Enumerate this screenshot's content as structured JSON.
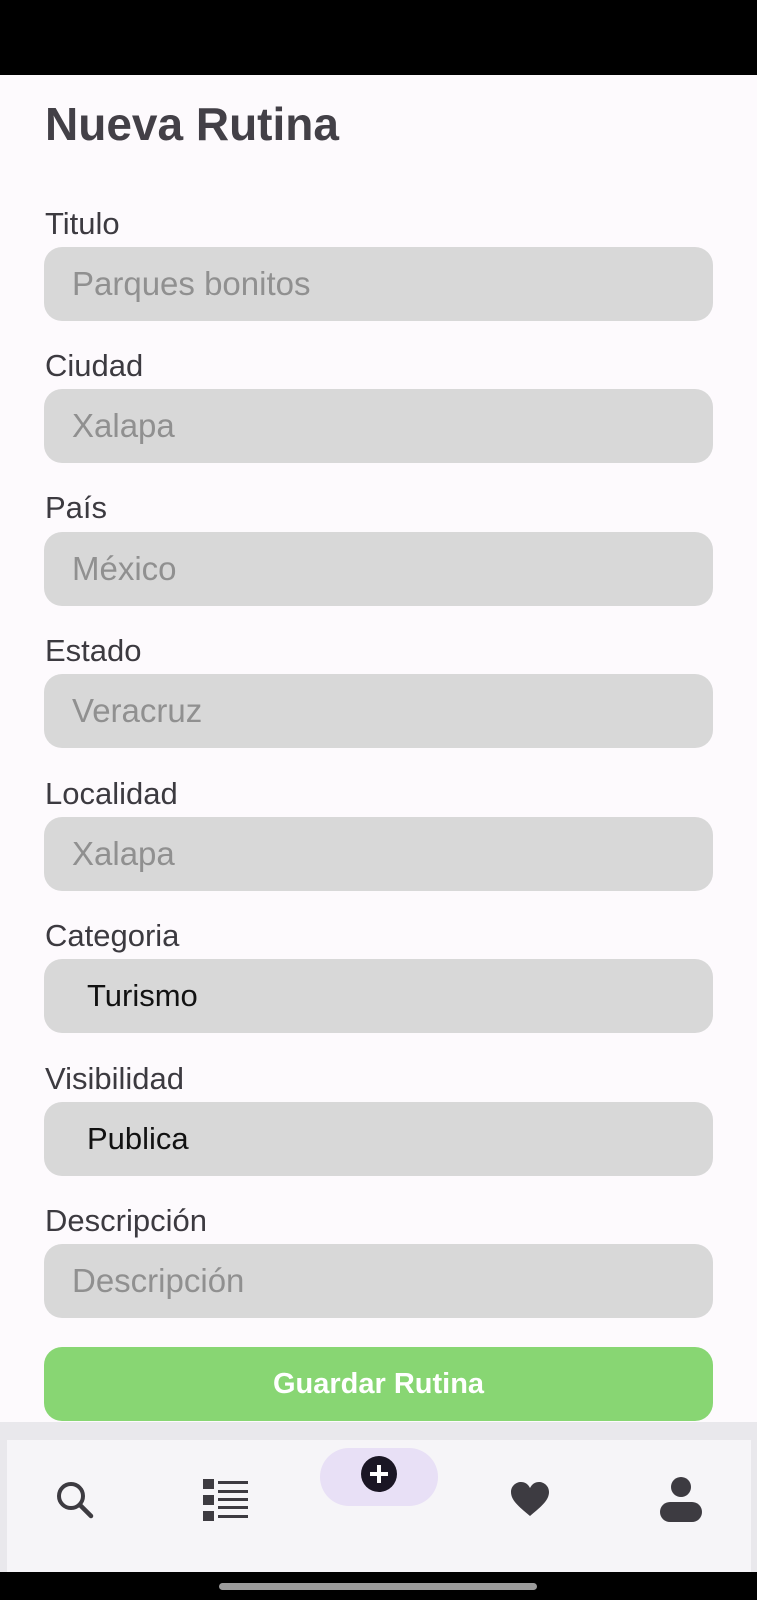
{
  "screen": {
    "title": "Nueva Rutina"
  },
  "form": {
    "titulo": {
      "label": "Titulo",
      "placeholder": "Parques bonitos"
    },
    "ciudad": {
      "label": "Ciudad",
      "placeholder": "Xalapa"
    },
    "pais": {
      "label": "País",
      "placeholder": "México"
    },
    "estado": {
      "label": "Estado",
      "placeholder": "Veracruz"
    },
    "localidad": {
      "label": "Localidad",
      "placeholder": "Xalapa"
    },
    "categoria": {
      "label": "Categoria",
      "value": "Turismo"
    },
    "visibilidad": {
      "label": "Visibilidad",
      "value": "Publica"
    },
    "descripcion": {
      "label": "Descripción",
      "placeholder": "Descripción"
    },
    "save_label": "Guardar Rutina"
  },
  "nav": {
    "items": [
      {
        "icon": "search-icon"
      },
      {
        "icon": "list-icon"
      },
      {
        "icon": "add-circle-icon",
        "selected": true
      },
      {
        "icon": "heart-icon"
      },
      {
        "icon": "person-icon"
      }
    ]
  },
  "colors": {
    "background": "#fdfafd",
    "input_bg": "#d8d8d8",
    "save_button": "#88d673",
    "nav_selected_pill": "#e8e0f6",
    "icon": "#3d3b41"
  }
}
